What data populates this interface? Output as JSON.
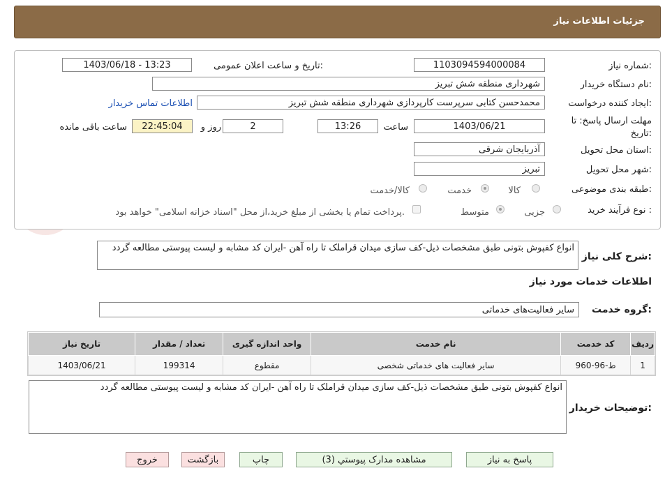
{
  "header": {
    "title": "جزئیات اطلاعات نیاز"
  },
  "fields": {
    "need_number_label": "شماره نیاز:",
    "need_number": "1103094594000084",
    "announce_label": "تاریخ و ساعت اعلان عمومی:",
    "announce_value": "1403/06/18 - 13:23",
    "buyer_org_label": "نام دستگاه خریدار:",
    "buyer_org": "شهرداری منطقه شش تبریز",
    "creator_label": "ایجاد کننده درخواست:",
    "creator": "محمدحسن کتابی سرپرست کارپردازی شهرداری منطقه شش تبریز",
    "contact_link": "اطلاعات تماس خریدار",
    "deadline_label_1": "مهلت ارسال پاسخ: تا",
    "deadline_label_2": "تاریخ:",
    "deadline_date": "1403/06/21",
    "hour_label": "ساعت",
    "deadline_time": "13:26",
    "days_value": "2",
    "days_label": "روز و",
    "remaining_time": "22:45:04",
    "remaining_label": "ساعت باقی مانده",
    "province_label": "استان محل تحویل:",
    "province": "آذربایجان شرقی",
    "city_label": "شهر محل تحویل:",
    "city": "تبریز",
    "category_label": "طبقه بندی موضوعی:",
    "category_options": [
      "کالا",
      "خدمت",
      "کالا/خدمت"
    ],
    "process_label": "نوع فرآیند خرید :",
    "process_options": [
      "جزیی",
      "متوسط"
    ],
    "payment_note": "پرداخت تمام یا بخشی از مبلغ خرید،از محل \"اسناد خزانه اسلامی\" خواهد بود."
  },
  "description": {
    "label": "شرح کلی نیاز:",
    "text": "انواع کفپوش بتونی طبق مشخصات ذیل-کف سازی میدان قراملک تا راه آهن -ایران کد مشابه و لیست پیوستی مطالعه گردد"
  },
  "services": {
    "section_title": "اطلاعات خدمات مورد نیاز",
    "group_label": "گروه خدمت:",
    "group_value": "سایر فعالیت‌های خدماتی",
    "columns": [
      "ردیف",
      "کد خدمت",
      "نام خدمت",
      "واحد اندازه گیری",
      "تعداد / مقدار",
      "تاریخ نیاز"
    ],
    "rows": [
      [
        "1",
        "ط-96-960",
        "سایر فعالیت های خدماتی شخصی",
        "مقطوع",
        "199314",
        "1403/06/21"
      ]
    ]
  },
  "buyer_notes": {
    "label": "توضیحات خریدار:",
    "text": "انواع کفپوش بتونی طبق مشخصات ذیل-کف سازی میدان قراملک تا راه آهن -ایران کد مشابه و لیست پیوستی مطالعه گردد"
  },
  "buttons": {
    "reply": "پاسخ به نیاز",
    "attachments": "مشاهده مدارک پیوستي (3)",
    "print": "چاپ",
    "back": "بازگشت",
    "exit": "خروج"
  },
  "colors": {
    "header_bg": "#8b6b47",
    "link": "#1a4fb3",
    "button_green": "#e9f7e4",
    "button_red": "#fbe0e0",
    "remaining_bg": "#fbf3c5"
  }
}
